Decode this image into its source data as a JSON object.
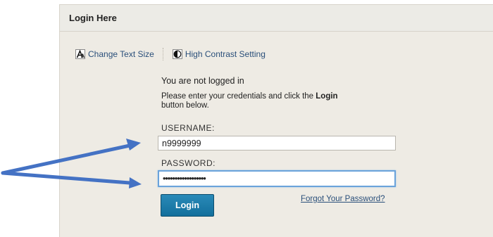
{
  "panel": {
    "title": "Login Here"
  },
  "accessibility": {
    "text_size_label": "Change Text Size",
    "text_size_icon": "font-size-icon",
    "contrast_label": "High Contrast Setting",
    "contrast_icon": "contrast-icon"
  },
  "login": {
    "status_text": "You are not logged in",
    "instructions_prefix": "Please enter your credentials and click the ",
    "instructions_bold": "Login",
    "instructions_suffix": " button below.",
    "username_label": "USERNAME:",
    "username_value": "n9999999",
    "password_label": "PASSWORD:",
    "password_value": "••••••••••••••••••",
    "login_button": "Login",
    "forgot_link": "Forgot Your Password?"
  },
  "annotation": {
    "arrow_color": "#4472c4",
    "arrow_icon": "annotation-arrow-icon"
  },
  "colors": {
    "panel_background": "#eeebe4",
    "link": "#2a4f7a",
    "button": "#1a7aab",
    "focus_border": "#6aa3db"
  }
}
